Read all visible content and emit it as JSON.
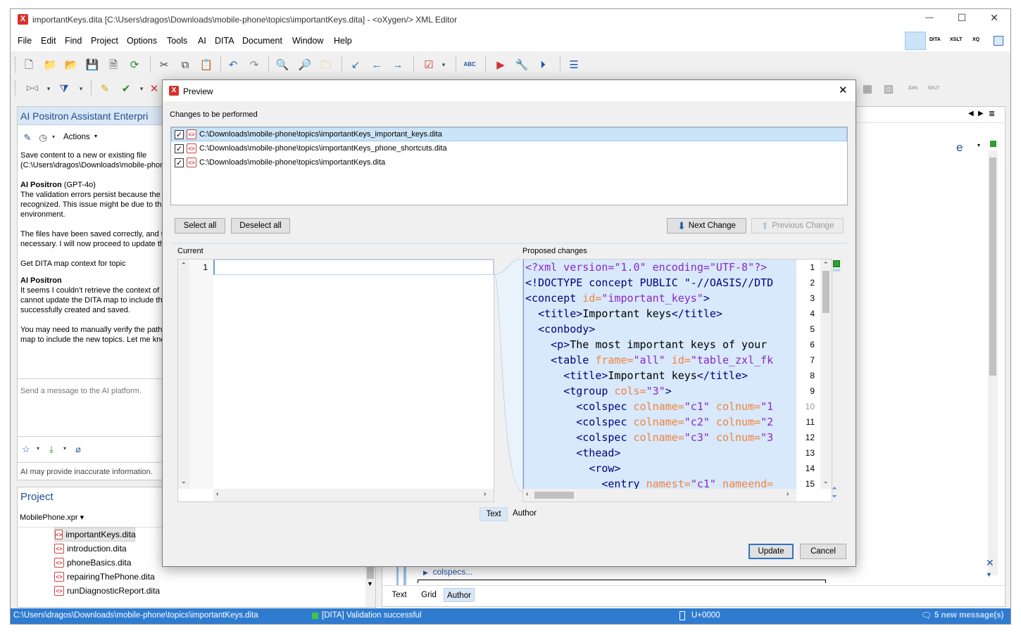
{
  "window": {
    "title": "importantKeys.dita [C:\\Users\\dragos\\Downloads\\mobile-phone\\topics\\importantKeys.dita] - <oXygen/> XML Editor",
    "minimize": "—",
    "maximize": "☐",
    "close": "✕"
  },
  "menu": [
    "File",
    "Edit",
    "Find",
    "Project",
    "Options",
    "Tools",
    "AI",
    "DITA",
    "Document",
    "Window",
    "Help"
  ],
  "perspectives": [
    "",
    "DITA",
    "XSLT",
    "XQ",
    ""
  ],
  "toolbar2_labels": {
    "join": "JOIN",
    "split": "SPLIT"
  },
  "ai_panel": {
    "title": "AI Positron Assistant Enterpri",
    "actions_label": "Actions",
    "messages": [
      {
        "type": "text",
        "lines": [
          "Save content to a new or existing file",
          "(C:\\Users\\dragos\\Downloads\\mobile-phon"
        ]
      },
      {
        "type": "author",
        "name": "AI Positron",
        "model": "(GPT-4o)"
      },
      {
        "type": "text",
        "lines": [
          "The validation errors persist because the r",
          "recognized. This issue might be due to the",
          "environment."
        ]
      },
      {
        "type": "text",
        "lines": [
          "The files have been saved correctly, and t",
          "necessary. I will now proceed to update th"
        ]
      },
      {
        "type": "text",
        "lines": [
          "Get DITA map context for topic"
        ]
      },
      {
        "type": "author",
        "name": "AI Positron",
        "model": ""
      },
      {
        "type": "text",
        "lines": [
          "It seems I couldn't retrieve the context of",
          "cannot update the DITA map to include th",
          "successfully created and saved."
        ]
      },
      {
        "type": "text",
        "lines": [
          "You may need to manually verify the path",
          "map to include the new topics. Let me kno"
        ]
      }
    ],
    "input_placeholder": "Send a message to the AI platform.",
    "disclaimer": "AI may provide inaccurate information."
  },
  "project": {
    "title": "Project",
    "file": "MobilePhone.xpr",
    "files": [
      "importantKeys.dita",
      "introduction.dita",
      "phoneBasics.dita",
      "repairingThePhone.dita",
      "runDiagnosticReport.dita"
    ]
  },
  "editor": {
    "bottom_tabs": [
      "Text",
      "Grid",
      "Author"
    ],
    "colspecs_label": "colspecs..."
  },
  "status_bar": {
    "path": "C:\\Users\\dragos\\Downloads\\mobile-phone\\topics\\importantKeys.dita",
    "validation": "[DITA] Validation successful",
    "unicode": "U+0000",
    "messages": "5 new message(s)"
  },
  "dialog": {
    "title": "Preview",
    "changes_label": "Changes to be performed",
    "changes": [
      {
        "path": "C:\\Downloads\\mobile-phone\\topics\\importantKeys_important_keys.dita",
        "checked": true,
        "selected": true
      },
      {
        "path": "C:\\Downloads\\mobile-phone\\topics\\importantKeys_phone_shortcuts.dita",
        "checked": true,
        "selected": false
      },
      {
        "path": "C:\\Downloads\\mobile-phone\\topics\\importantKeys.dita",
        "checked": true,
        "selected": false
      }
    ],
    "select_all": "Select all",
    "deselect_all": "Deselect all",
    "next_change": "Next Change",
    "previous_change": "Previous Change",
    "current_label": "Current",
    "proposed_label": "Proposed changes",
    "current_line_numbers": [
      "1"
    ],
    "proposed_line_numbers": [
      "1",
      "2",
      "3",
      "4",
      "5",
      "6",
      "7",
      "8",
      "9",
      "10",
      "11",
      "12",
      "13",
      "14",
      "15"
    ],
    "view_tabs": [
      "Text",
      "Author"
    ],
    "update": "Update",
    "cancel": "Cancel",
    "checkmark": "✓"
  }
}
